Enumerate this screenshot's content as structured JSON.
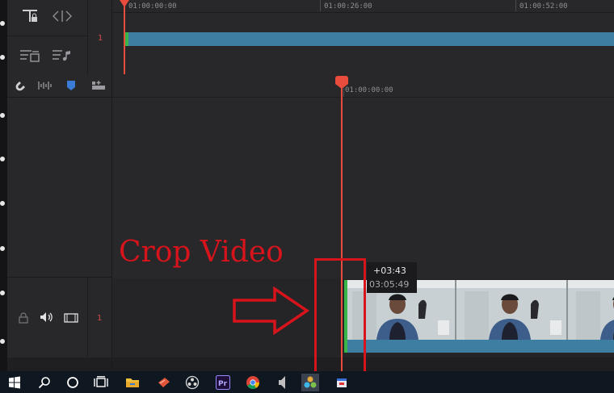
{
  "top_ruler": {
    "tc1": "01:00:00:00",
    "tc2": "01:00:26:00",
    "tc3": "01:00:52:00"
  },
  "top_track": {
    "number": "1"
  },
  "detail_ruler": {
    "tc": "01:00:00:00"
  },
  "video_track": {
    "number": "1"
  },
  "tooltip": {
    "offset": "+03:43",
    "time": "03:05:49"
  },
  "annotation": {
    "text": "Crop Video"
  },
  "icons": {
    "toolbar": [
      "snap-magnet-icon",
      "audio-waveform-icon",
      "marker-flag-icon",
      "add-track-icon"
    ],
    "top_head": [
      "lock-timeline-icon",
      "code-brackets-icon",
      "video-track-options-icon",
      "audio-track-options-icon"
    ],
    "track_controls": [
      "lock-icon",
      "speaker-icon",
      "film-icon"
    ],
    "taskbar": [
      "windows-start-icon",
      "search-icon",
      "cortana-icon",
      "task-view-icon",
      "file-explorer-icon",
      "app-red-icon",
      "obs-icon",
      "premiere-pro-icon",
      "chrome-icon",
      "audio-app-icon",
      "davinci-resolve-icon",
      "app-calendar-icon"
    ]
  },
  "colors": {
    "playhead": "#e84c3d",
    "annotation": "#d7141b",
    "clip": "#3f7ea3",
    "clip_start": "#39b54a"
  }
}
